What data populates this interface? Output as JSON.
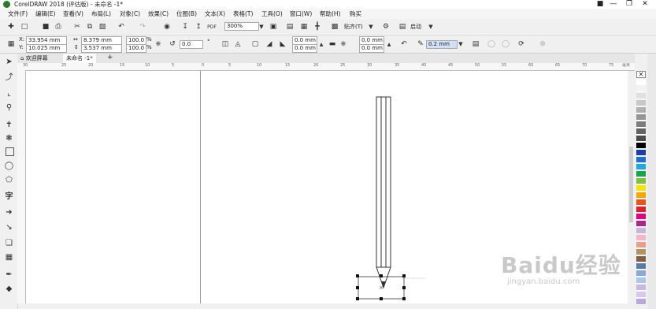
{
  "app": {
    "title": "CorelDRAW 2018 (评估版) - 未命名 -1*"
  },
  "menu": [
    "文件(F)",
    "编辑(E)",
    "查看(V)",
    "布局(L)",
    "对象(C)",
    "效果(C)",
    "位图(B)",
    "文本(X)",
    "表格(T)",
    "工具(O)",
    "窗口(W)",
    "帮助(H)",
    "购买"
  ],
  "toolbar": {
    "zoom": "300%",
    "snap_label": "贴齐(T)",
    "launch_label": "启动"
  },
  "propertybar": {
    "x": "33.954 mm",
    "y": "10.025 mm",
    "width": "8.379 mm",
    "height": "3.537 mm",
    "scale_x": "100.0",
    "scale_y": "100.0",
    "percent": "%",
    "rotation": "0.0",
    "degree": "°",
    "corner_top": "0.0 mm",
    "corner_bottom": "0.0 mm",
    "corner2_top": "0.0 mm",
    "corner2_bottom": "0.0 mm",
    "outline": "0.2 mm"
  },
  "tabs": [
    {
      "label": "欢迎屏幕"
    },
    {
      "label": "未命名 -1*"
    }
  ],
  "ruler": {
    "top_ticks": [
      "30",
      "25",
      "20",
      "15",
      "10",
      "5",
      "0",
      "5",
      "10",
      "15",
      "20",
      "25",
      "30",
      "35",
      "40",
      "45",
      "50",
      "55",
      "60",
      "65",
      "70",
      "75"
    ],
    "unit": "毫米"
  },
  "palette": {
    "colors": [
      "#ffffff",
      "#f2f2f2",
      "#e0e0e0",
      "#c8c8c8",
      "#b0b0b0",
      "#969696",
      "#7d7d7d",
      "#646464",
      "#4b4b4b",
      "#000000",
      "#1c3ea8",
      "#1e6fd0",
      "#22a7e0",
      "#1aa34a",
      "#7cc242",
      "#f5e400",
      "#f7a600",
      "#e8541c",
      "#d9222a",
      "#e4007f",
      "#a7278a",
      "#c9b6d8",
      "#f4b6c7",
      "#e8a08a",
      "#b39160",
      "#806040",
      "#5a7aa8",
      "#8aa8d8",
      "#a8c8e8",
      "#c8b8e0",
      "#d8c8f0",
      "#b8a8e0"
    ]
  },
  "watermark": {
    "text": "Baidu经验",
    "sub": "jingyan.baidu.com"
  }
}
